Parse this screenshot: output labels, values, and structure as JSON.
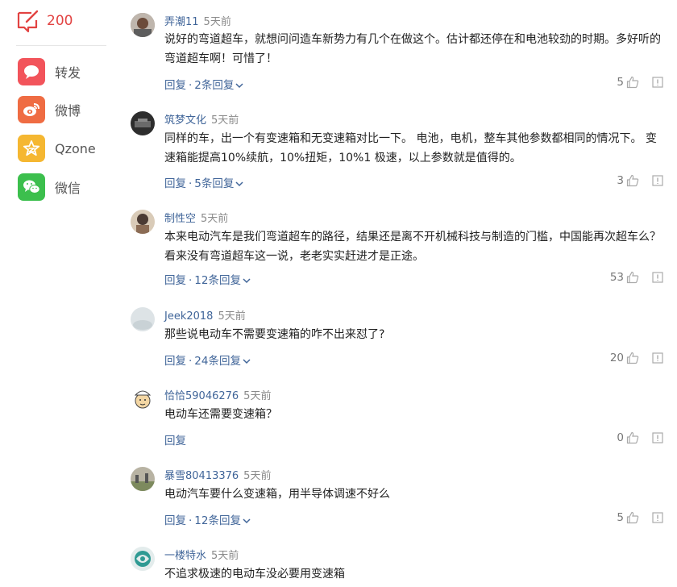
{
  "sidebar": {
    "comment_total": "200",
    "share": [
      {
        "label": "转发",
        "icon": "chat-bubble-icon",
        "color": "#f2545b"
      },
      {
        "label": "微博",
        "icon": "weibo-icon",
        "color": "#ef6c43"
      },
      {
        "label": "Qzone",
        "icon": "qzone-star-icon",
        "color": "#f5b731"
      },
      {
        "label": "微信",
        "icon": "wechat-icon",
        "color": "#3cbf4d"
      }
    ]
  },
  "comments": [
    {
      "user": "弄潮11",
      "time": "5天前",
      "text": "说好的弯道超车，就想问问造车新势力有几个在做这个。估计都还停在和电池较劲的时期。多好听的弯道超车啊！可惜了！",
      "reply": "回复",
      "replies": "2条回复",
      "likes": "5"
    },
    {
      "user": "筑梦文化",
      "time": "5天前",
      "text": "同样的车，出一个有变速箱和无变速箱对比一下。 电池，电机，整车其他参数都相同的情况下。 变速箱能提高10%续航，10%扭矩，10%1 极速，以上参数就是值得的。",
      "reply": "回复",
      "replies": "5条回复",
      "likes": "3"
    },
    {
      "user": "制性空",
      "time": "5天前",
      "text": "本来电动汽车是我们弯道超车的路径，结果还是离不开机械科技与制造的门槛，中国能再次超车么？看来没有弯道超车这一说，老老实实赶进才是正途。",
      "reply": "回复",
      "replies": "12条回复",
      "likes": "53"
    },
    {
      "user": "Jeek2018",
      "time": "5天前",
      "text": "那些说电动车不需要变速箱的咋不出来怼了?",
      "reply": "回复",
      "replies": "24条回复",
      "likes": "20"
    },
    {
      "user": "恰恰59046276",
      "time": "5天前",
      "text": "电动车还需要变速箱？",
      "reply": "回复",
      "replies": "",
      "likes": "0"
    },
    {
      "user": "暴雪80413376",
      "time": "5天前",
      "text": "电动汽车要什么变速箱，用半导体调速不好么",
      "reply": "回复",
      "replies": "12条回复",
      "likes": "5"
    },
    {
      "user": "一楼特水",
      "time": "5天前",
      "text": "不追求极速的电动车没必要用变速箱",
      "reply": "",
      "replies": "",
      "likes": ""
    }
  ],
  "ui": {
    "separator": "·"
  }
}
